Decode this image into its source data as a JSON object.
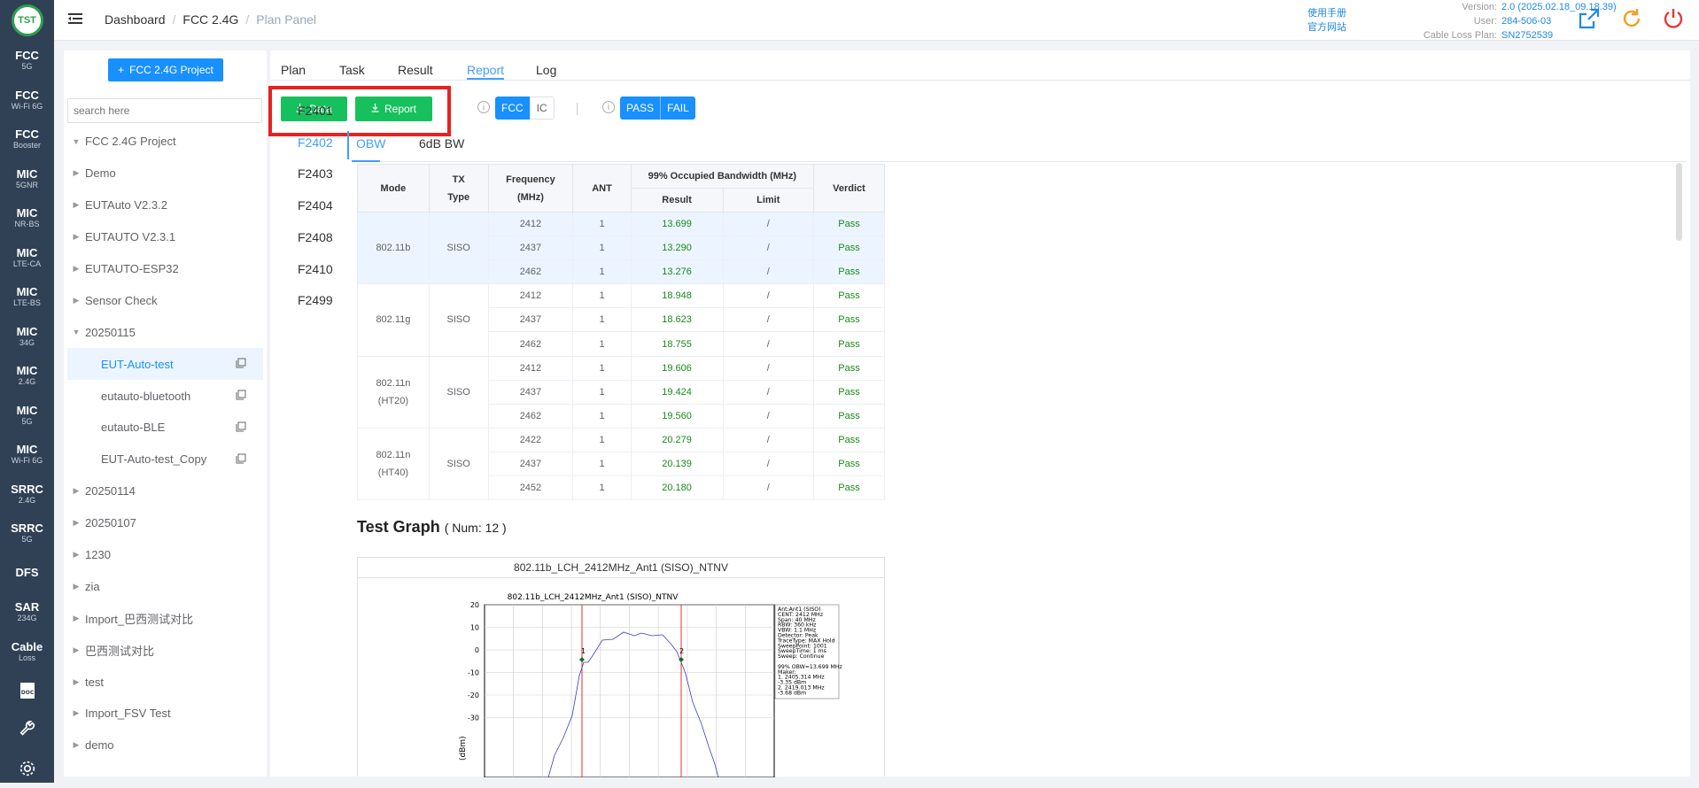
{
  "logo": "TST",
  "sidebar": {
    "items": [
      {
        "title": "FCC",
        "sub": "5G"
      },
      {
        "title": "FCC",
        "sub": "Wi-Fi 6G"
      },
      {
        "title": "FCC",
        "sub": "Booster"
      },
      {
        "title": "MIC",
        "sub": "5GNR"
      },
      {
        "title": "MIC",
        "sub": "NR-BS"
      },
      {
        "title": "MIC",
        "sub": "LTE-CA"
      },
      {
        "title": "MIC",
        "sub": "LTE-BS"
      },
      {
        "title": "MIC",
        "sub": "34G"
      },
      {
        "title": "MIC",
        "sub": "2.4G"
      },
      {
        "title": "MIC",
        "sub": "5G"
      },
      {
        "title": "MIC",
        "sub": "Wi-Fi 6G"
      },
      {
        "title": "SRRC",
        "sub": "2.4G"
      },
      {
        "title": "SRRC",
        "sub": "5G"
      },
      {
        "title": "DFS",
        "sub": ""
      },
      {
        "title": "SAR",
        "sub": "234G"
      },
      {
        "title": "Cable",
        "sub": "Loss"
      }
    ],
    "doc_label": "DOC"
  },
  "header": {
    "breadcrumb": [
      "Dashboard",
      "FCC 2.4G",
      "Plan Panel"
    ],
    "manual_link": "使用手册",
    "website_link": "官方网站",
    "version_key": "Version:",
    "version_val": "2.0 (2025.02.18_09.18.39)",
    "user_key": "User:",
    "user_val": "284-506-03",
    "cable_key": "Cable Loss Plan:",
    "cable_val": "SN2752539"
  },
  "tree": {
    "project_button": "FCC 2.4G Project",
    "search_placeholder": "search here",
    "nodes": [
      {
        "label": "FCC 2.4G Project",
        "arrow": "▼",
        "level": 0
      },
      {
        "label": "Demo",
        "arrow": "▶",
        "level": 0
      },
      {
        "label": "EUTAuto V2.3.2",
        "arrow": "▶",
        "level": 0
      },
      {
        "label": "EUTAUTO V2.3.1",
        "arrow": "▶",
        "level": 0
      },
      {
        "label": "EUTAUTO-ESP32",
        "arrow": "▶",
        "level": 0
      },
      {
        "label": "Sensor Check",
        "arrow": "▶",
        "level": 0
      },
      {
        "label": "20250115",
        "arrow": "▼",
        "level": 0
      },
      {
        "label": "EUT-Auto-test",
        "arrow": "",
        "level": 1,
        "active": true
      },
      {
        "label": "eutauto-bluetooth",
        "arrow": "",
        "level": 1
      },
      {
        "label": "eutauto-BLE",
        "arrow": "",
        "level": 1
      },
      {
        "label": "EUT-Auto-test_Copy",
        "arrow": "",
        "level": 1
      },
      {
        "label": "20250114",
        "arrow": "▶",
        "level": 0
      },
      {
        "label": "20250107",
        "arrow": "▶",
        "level": 0
      },
      {
        "label": "1230",
        "arrow": "▶",
        "level": 0
      },
      {
        "label": "zia",
        "arrow": "▶",
        "level": 0
      },
      {
        "label": "Import_巴西测试对比",
        "arrow": "▶",
        "level": 0
      },
      {
        "label": "巴西测试对比",
        "arrow": "▶",
        "level": 0
      },
      {
        "label": "test",
        "arrow": "▶",
        "level": 0
      },
      {
        "label": "Import_FSV Test",
        "arrow": "▶",
        "level": 0
      },
      {
        "label": "demo",
        "arrow": "▶",
        "level": 0
      }
    ]
  },
  "main": {
    "tabs": [
      "Plan",
      "Task",
      "Result",
      "Report",
      "Log"
    ],
    "data_button": "Data",
    "report_button": "Report",
    "std": {
      "fcc": "FCC",
      "ic": "IC"
    },
    "verdict": {
      "pass": "PASS",
      "fail": "FAIL"
    },
    "freq_tabs": [
      "F2401",
      "F2402",
      "F2403",
      "F2404",
      "F2408",
      "F2410",
      "F2499"
    ],
    "sub_tabs": [
      "OBW",
      "6dB BW"
    ],
    "table": {
      "headers": {
        "mode": "Mode",
        "tx": "TX",
        "tx2": "Type",
        "freq": "Frequency",
        "freq2": "(MHz)",
        "ant": "ANT",
        "obw": "99% Occupied Bandwidth (MHz)",
        "result": "Result",
        "limit": "Limit",
        "verdict": "Verdict"
      },
      "groups": [
        {
          "mode": "802.11b",
          "mode2": "",
          "tx": "SISO",
          "rows": [
            [
              "2412",
              "1",
              "13.699",
              "/",
              "Pass"
            ],
            [
              "2437",
              "1",
              "13.290",
              "/",
              "Pass"
            ],
            [
              "2462",
              "1",
              "13.276",
              "/",
              "Pass"
            ]
          ]
        },
        {
          "mode": "802.11g",
          "mode2": "",
          "tx": "SISO",
          "rows": [
            [
              "2412",
              "1",
              "18.948",
              "/",
              "Pass"
            ],
            [
              "2437",
              "1",
              "18.623",
              "/",
              "Pass"
            ],
            [
              "2462",
              "1",
              "18.755",
              "/",
              "Pass"
            ]
          ]
        },
        {
          "mode": "802.11n",
          "mode2": "(HT20)",
          "tx": "SISO",
          "rows": [
            [
              "2412",
              "1",
              "19.606",
              "/",
              "Pass"
            ],
            [
              "2437",
              "1",
              "19.424",
              "/",
              "Pass"
            ],
            [
              "2462",
              "1",
              "19.560",
              "/",
              "Pass"
            ]
          ]
        },
        {
          "mode": "802.11n",
          "mode2": "(HT40)",
          "tx": "SISO",
          "rows": [
            [
              "2422",
              "1",
              "20.279",
              "/",
              "Pass"
            ],
            [
              "2437",
              "1",
              "20.139",
              "/",
              "Pass"
            ],
            [
              "2452",
              "1",
              "20.180",
              "/",
              "Pass"
            ]
          ]
        }
      ]
    },
    "test_graph": {
      "title": "Test Graph",
      "num": "( Num: 12 )",
      "graph_title": "802.11b_LCH_2412MHz_Ant1 (SISO)_NTNV",
      "plot_title": "802.11b_LCH_2412MHz_Ant1 (SISO)_NTNV",
      "ylabel": "(dBm)",
      "yticks": [
        "20",
        "10",
        "0",
        "-10",
        "-20",
        "-30"
      ],
      "legend": [
        "Ant:Ant1 (SISO)",
        "CENT: 2412 MHz",
        "Span: 40 MHz",
        "RBW: 360 kHz",
        "VBW: 1.1 MHz",
        "Detector: Peak",
        "TraceType: MAX Hold",
        "SweepPoint: 1001",
        "SweepTime: 1 ms",
        "Sweep: Continue",
        "",
        "99% OBW=13.699 MHz",
        "Maker:",
        "1. 2405.314 MHz",
        "    -3.35 dBm",
        "2. 2419.013 MHz",
        "    -3.68 dBm"
      ],
      "markers": [
        "1",
        "2"
      ]
    }
  },
  "colors": {
    "accent": "#409eff",
    "green": "#16c15d",
    "highlight": "#e62222",
    "sidebar": "#304156"
  }
}
